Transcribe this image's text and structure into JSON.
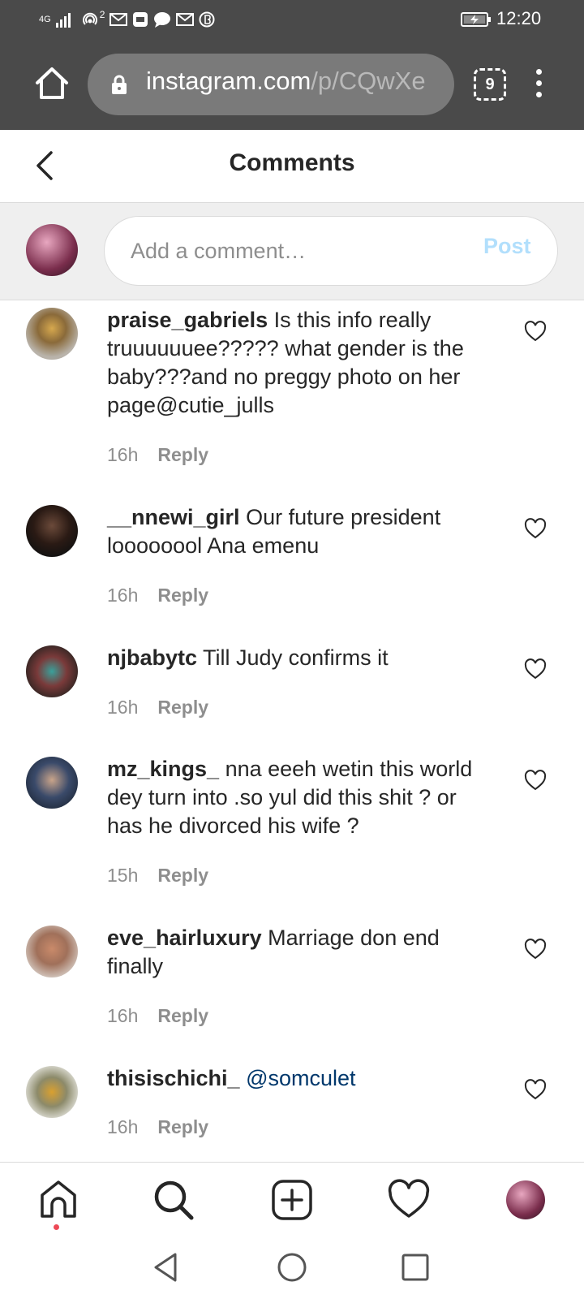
{
  "status_bar": {
    "icons": [
      "4G",
      "signal-icon",
      "hotspot-icon",
      "mail-icon",
      "app-icon",
      "chat-icon",
      "mail-icon",
      "app-icon"
    ],
    "network_label": "4G",
    "hotspot_count": "2",
    "time": "12:20"
  },
  "browser": {
    "url_host": "instagram.com",
    "url_path": "/p/CQwXe",
    "tab_count": "9"
  },
  "header": {
    "title": "Comments"
  },
  "composer": {
    "placeholder": "Add a comment…",
    "post_label": "Post"
  },
  "comments": [
    {
      "username": "praise_gabriels",
      "text": "Is this info really truuuuuuee????? what gender is the baby???and no preggy photo on her page@cutie_julls",
      "time": "16h",
      "reply_label": "Reply"
    },
    {
      "username": "__nnewi_girl",
      "text": "Our future president loooooool Ana emenu",
      "time": "16h",
      "reply_label": "Reply"
    },
    {
      "username": "njbabytc",
      "text": "Till Judy confirms it",
      "time": "16h",
      "reply_label": "Reply"
    },
    {
      "username": "mz_kings_",
      "text": "nna eeeh wetin this world dey turn into .so yul did this shit ? or has he divorced his wife ?",
      "time": "15h",
      "reply_label": "Reply"
    },
    {
      "username": "eve_hairluxury",
      "text": "Marriage don end finally",
      "time": "16h",
      "reply_label": "Reply"
    },
    {
      "username": "thisischichi_",
      "mention": "@somculet",
      "time": "16h",
      "reply_label": "Reply"
    }
  ],
  "bottom_nav": [
    "home-icon",
    "search-icon",
    "new-post-icon",
    "activity-heart-icon",
    "profile-avatar"
  ],
  "colors": {
    "chrome": "#4a4a4a",
    "accent_disabled": "#b2dffc",
    "mention": "#00376b",
    "notification_dot": "#ed4956"
  }
}
